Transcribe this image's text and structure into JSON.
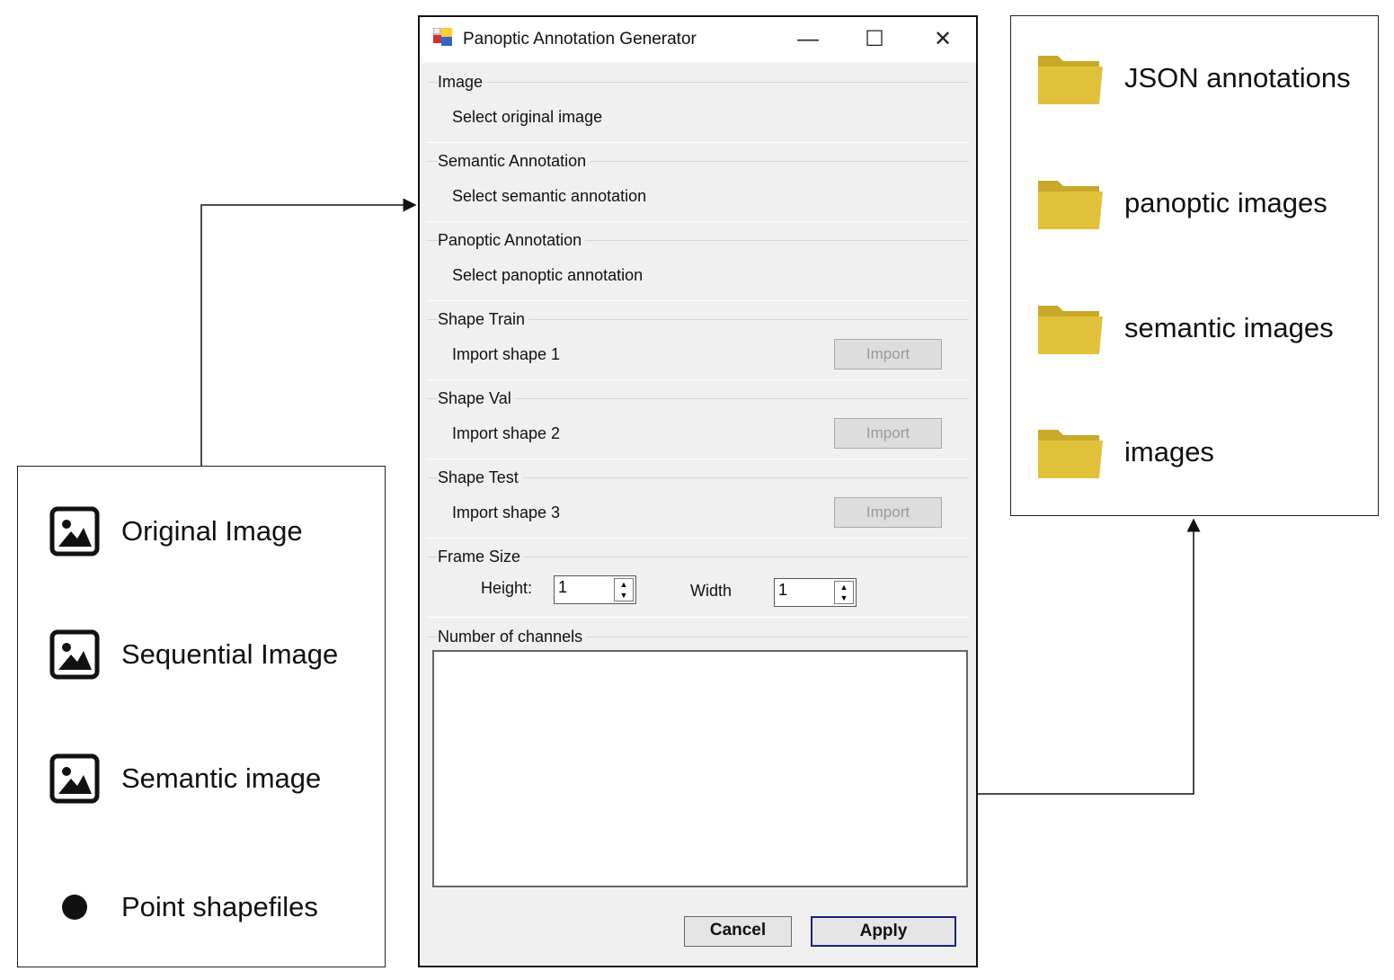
{
  "legend": {
    "items": [
      {
        "icon": "image-icon",
        "label": "Original Image"
      },
      {
        "icon": "image-icon",
        "label": "Sequential Image"
      },
      {
        "icon": "image-icon",
        "label": "Semantic image"
      },
      {
        "icon": "point-icon",
        "label": "Point shapefiles"
      }
    ]
  },
  "outputs": {
    "items": [
      {
        "icon": "folder-icon",
        "label": "JSON annotations"
      },
      {
        "icon": "folder-icon",
        "label": "panoptic images"
      },
      {
        "icon": "folder-icon",
        "label": "semantic images"
      },
      {
        "icon": "folder-icon",
        "label": "images"
      }
    ]
  },
  "window": {
    "title": "Panoptic Annotation Generator",
    "controls": {
      "minimize": "—",
      "maximize": "☐",
      "close": "✕"
    },
    "groups": [
      {
        "title": "Image",
        "row": "Select original image"
      },
      {
        "title": "Semantic Annotation",
        "row": "Select semantic annotation"
      },
      {
        "title": "Panoptic Annotation",
        "row": "Select panoptic annotation"
      },
      {
        "title": "Shape Train",
        "row": "Import shape 1",
        "button": "Import"
      },
      {
        "title": "Shape Val",
        "row": "Import shape 2",
        "button": "Import"
      },
      {
        "title": "Shape Test",
        "row": "Import shape 3",
        "button": "Import"
      }
    ],
    "frame_size": {
      "title": "Frame Size",
      "height_label": "Height:",
      "height_value": "1",
      "width_label": "Width",
      "width_value": "1"
    },
    "channels": {
      "title": "Number of channels"
    },
    "cancel": "Cancel",
    "apply": "Apply"
  },
  "colors": {
    "folder": "#e2c13a",
    "apply_border": "#1a237e"
  }
}
